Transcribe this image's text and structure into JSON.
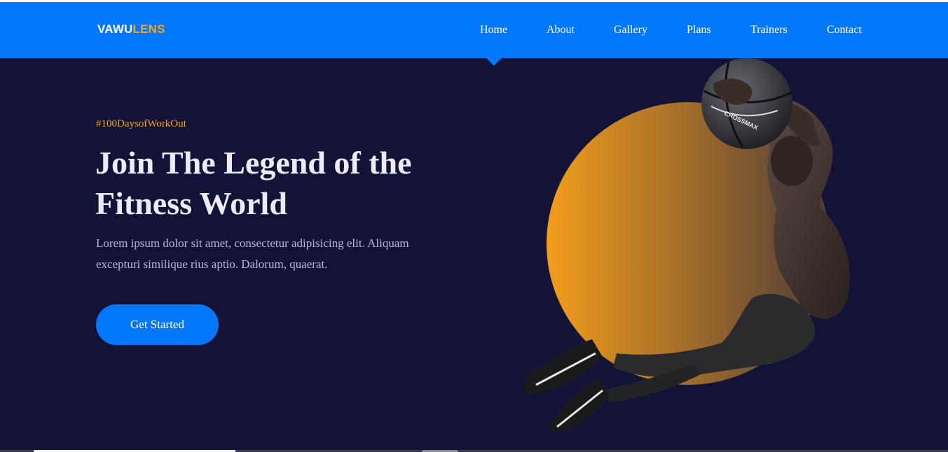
{
  "brand": {
    "logo_part1": "VAWU",
    "logo_part2": "LENS"
  },
  "nav": {
    "items": [
      {
        "label": "Home"
      },
      {
        "label": "About"
      },
      {
        "label": "Gallery"
      },
      {
        "label": "Plans"
      },
      {
        "label": "Trainers"
      },
      {
        "label": "Contact"
      }
    ],
    "active": "Home"
  },
  "hero": {
    "tagline": "#100DaysofWorkOut",
    "headline": "Join The Legend of the Fitness World",
    "description": "Lorem ipsum dolor sit amet, consectetur adipisicing elit. Aliquam excepturi similique rius aptio. Dalorum, quaerat.",
    "cta_label": "Get Started",
    "ball_text": "CROSSMAX"
  },
  "colors": {
    "nav_bg": "#0378fa",
    "page_bg": "#131338",
    "accent": "#f2a61b",
    "circle_gradient_start": "#f29d1c",
    "circle_gradient_end": "#4e3c3a"
  }
}
